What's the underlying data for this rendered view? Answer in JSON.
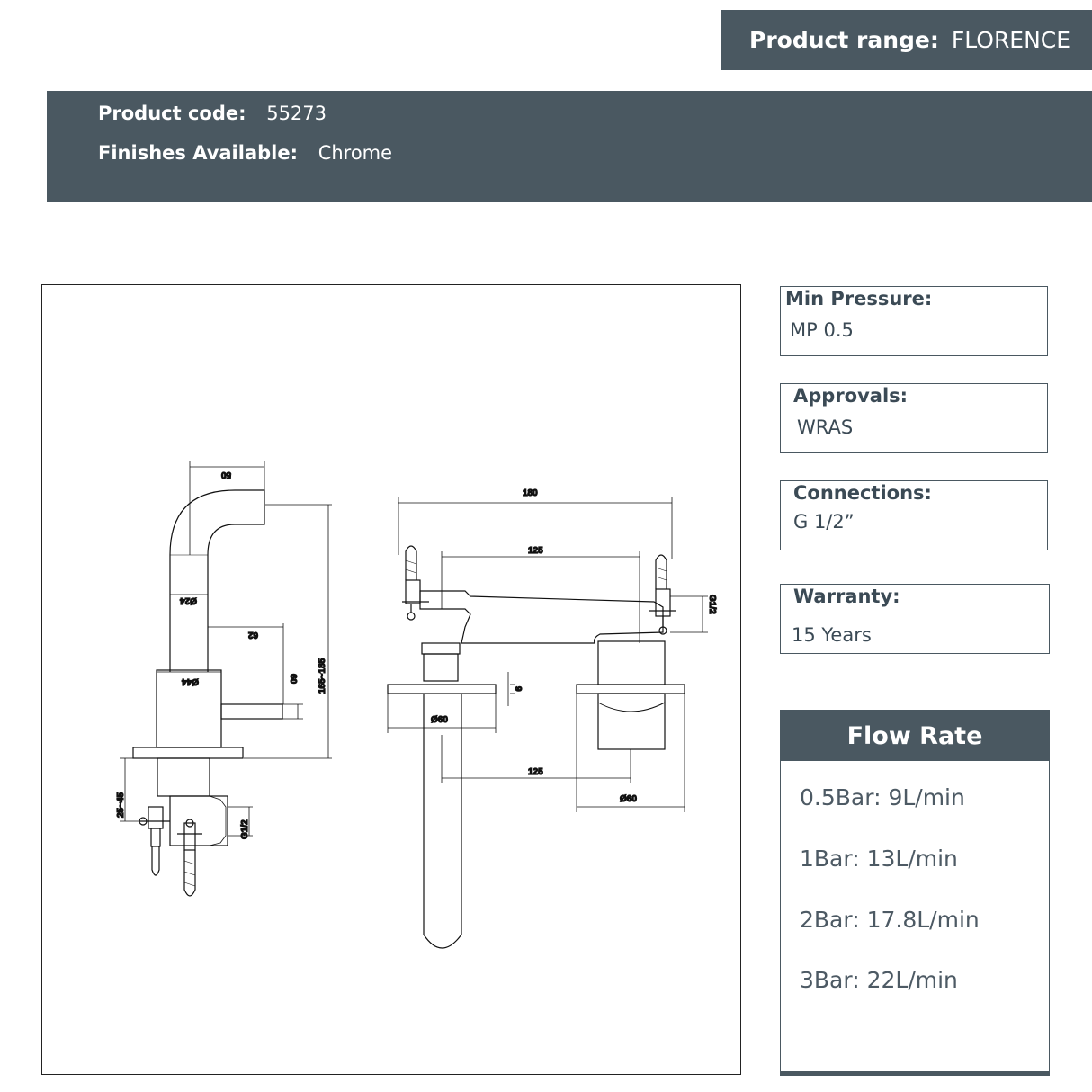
{
  "header": {
    "range_label": "Product range:",
    "range_value": "FLORENCE",
    "code_label": "Product code:",
    "code_value": "55273",
    "finishes_label": "Finishes Available:",
    "finishes_value": "Chrome"
  },
  "specs": [
    {
      "label": "Min Pressure:",
      "value": "MP 0.5"
    },
    {
      "label": "Approvals:",
      "value": "WRAS"
    },
    {
      "label": "Connections:",
      "value": "G 1/2”"
    },
    {
      "label": "Warranty:",
      "value": "15 Years"
    }
  ],
  "flow_rate": {
    "title": "Flow Rate",
    "items": [
      "0.5Bar: 9L/min",
      "1Bar: 13L/min",
      "2Bar: 17.8L/min",
      "3Bar: 22L/min"
    ]
  },
  "drawing": {
    "side_dims": [
      "50",
      "Ø24",
      "62",
      "165~185",
      "Ø44",
      "60",
      "25~45",
      "G1/2"
    ],
    "front_dims": [
      "180",
      "125",
      "G1/2",
      "9",
      "Ø60",
      "125",
      "Ø60"
    ]
  }
}
